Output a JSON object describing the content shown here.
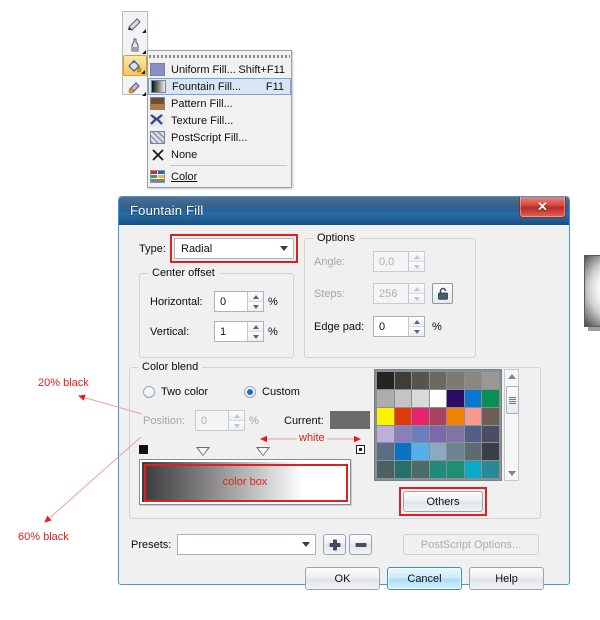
{
  "toolbar": {
    "tools": [
      {
        "name": "outline-pen-tool"
      },
      {
        "name": "outline-color-tool"
      },
      {
        "name": "fill-tool"
      },
      {
        "name": "interactive-fill-tool"
      }
    ]
  },
  "flyout": {
    "items": [
      {
        "label": "Uniform Fill...",
        "shortcut": "Shift+F11",
        "icon": "uniform-fill-icon",
        "active": false
      },
      {
        "label": "Fountain Fill...",
        "shortcut": "F11",
        "icon": "fountain-fill-icon",
        "active": true
      },
      {
        "label": "Pattern Fill...",
        "shortcut": "",
        "icon": "pattern-fill-icon",
        "active": false
      },
      {
        "label": "Texture Fill...",
        "shortcut": "",
        "icon": "texture-fill-icon",
        "active": false
      },
      {
        "label": "PostScript Fill...",
        "shortcut": "",
        "icon": "postscript-fill-icon",
        "active": false
      },
      {
        "label": "None",
        "shortcut": "",
        "icon": "none-x-icon",
        "active": false
      }
    ],
    "color_item": {
      "label": "Color",
      "icon": "color-docker-icon"
    }
  },
  "dialog": {
    "title": "Fountain Fill",
    "close_label": "✕",
    "type_label": "Type:",
    "type_value": "Radial",
    "center_offset": {
      "title": "Center offset",
      "horizontal_label": "Horizontal:",
      "horizontal_value": "0",
      "horizontal_unit": "%",
      "vertical_label": "Vertical:",
      "vertical_value": "1",
      "vertical_unit": "%"
    },
    "options": {
      "title": "Options",
      "angle_label": "Angle:",
      "angle_value": "0,0",
      "steps_label": "Steps:",
      "steps_value": "256",
      "lock_icon": "padlock-icon",
      "edge_pad_label": "Edge pad:",
      "edge_pad_value": "0",
      "edge_pad_unit": "%"
    },
    "color_blend": {
      "title": "Color blend",
      "two_color_label": "Two color",
      "two_color_selected": false,
      "custom_label": "Custom",
      "custom_selected": true,
      "position_label": "Position:",
      "position_value": "0",
      "position_unit": "%",
      "current_label": "Current:",
      "current_color": "#6b6b6b",
      "others_label": "Others"
    },
    "presets": {
      "label": "Presets:",
      "value": "",
      "add_icon": "plus-icon",
      "remove_icon": "minus-icon"
    },
    "postscript_options_label": "PostScript Options...",
    "buttons": {
      "ok": "OK",
      "cancel": "Cancel",
      "help": "Help"
    }
  },
  "annotations": {
    "accent_color": "#e02020",
    "labels": [
      {
        "text": "20% black",
        "name": "annotation-20-percent-black"
      },
      {
        "text": "60% black",
        "name": "annotation-60-percent-black"
      },
      {
        "text": "white",
        "name": "annotation-white"
      },
      {
        "text": "color box",
        "name": "annotation-color-box"
      }
    ]
  },
  "palette": {
    "swatches": [
      "#262420",
      "#403d39",
      "#57544e",
      "#6b6762",
      "#7d7a75",
      "#8b8884",
      "#9a9794",
      "#adadad",
      "#c4c4c4",
      "#d9d9d9",
      "#ffffff",
      "#2b0a63",
      "#0a78cf",
      "#0b8f56",
      "#fbf200",
      "#e03a0a",
      "#e8246e",
      "#a8425f",
      "#f08407",
      "#f79a8f",
      "#6e5d55",
      "#bbb0d8",
      "#8a7ebe",
      "#6b7fc0",
      "#7a6aac",
      "#7e75a6",
      "#4f5f86",
      "#4d4c66",
      "#5a6c86",
      "#0a73c8",
      "#54b0ea",
      "#8ba9c0",
      "#6e8391",
      "#5d6a72",
      "#3a3f45",
      "#4a6160",
      "#27706a",
      "#4c6a68",
      "#1f8a7f",
      "#1f8f72",
      "#0aa9c8",
      "#2a8898"
    ]
  }
}
